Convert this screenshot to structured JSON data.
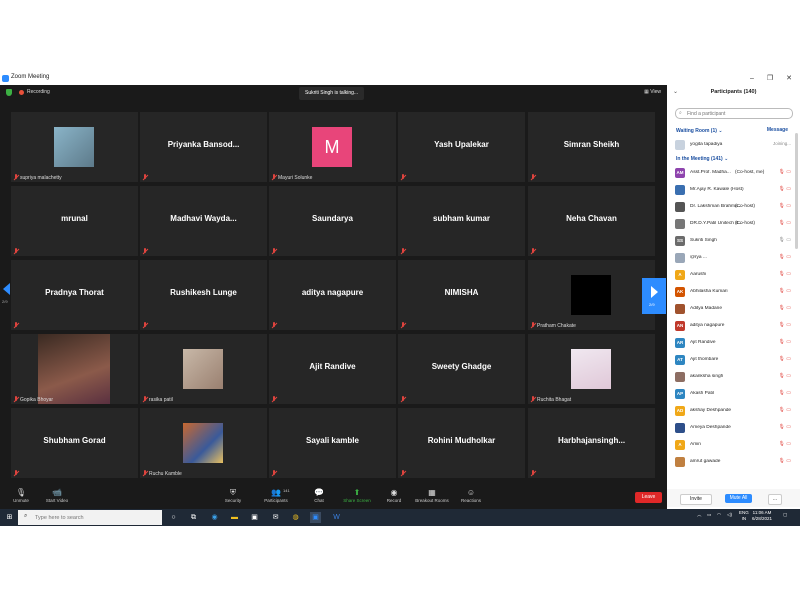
{
  "window": {
    "title": "Zoom Meeting",
    "controls": [
      "–",
      "❐",
      "✕"
    ]
  },
  "meeting": {
    "recording_label": "Recording",
    "talking_text": "Sukriti Singh is talking...",
    "view_label": "View",
    "page_prev": "2/9",
    "page_next": "2/9",
    "tiles": [
      {
        "name": "supriya malachetty",
        "type": "video"
      },
      {
        "name": "Priyanka  Bansod...",
        "type": "name"
      },
      {
        "name": "Mayuri Solunke",
        "type": "avatar",
        "letter": "M"
      },
      {
        "name": "Yash Upalekar",
        "type": "name"
      },
      {
        "name": "Simran Sheikh",
        "type": "name"
      },
      {
        "name": "mrunal",
        "type": "name"
      },
      {
        "name": "Madhavi Wayda...",
        "type": "name"
      },
      {
        "name": "Saundarya",
        "type": "name"
      },
      {
        "name": "subham kumar",
        "type": "name"
      },
      {
        "name": "Neha Chavan",
        "type": "name"
      },
      {
        "name": "Pradnya Thorat",
        "type": "name"
      },
      {
        "name": "Rushikesh Lunge",
        "type": "name"
      },
      {
        "name": "aditya nagapure",
        "type": "name"
      },
      {
        "name": "NIMISHA",
        "type": "name"
      },
      {
        "name": "Pratham Chakate",
        "type": "video"
      },
      {
        "name": "Gopika Bhoyar",
        "type": "video"
      },
      {
        "name": "rasika patil",
        "type": "video"
      },
      {
        "name": "Ajit Randive",
        "type": "name"
      },
      {
        "name": "Sweety Ghadge",
        "type": "name"
      },
      {
        "name": "Ruchita Bhagat",
        "type": "video"
      },
      {
        "name": "Shubham Gorad",
        "type": "name"
      },
      {
        "name": "Ruchu Kamble",
        "type": "video"
      },
      {
        "name": "Sayali kamble",
        "type": "name"
      },
      {
        "name": "Rohini Mudholkar",
        "type": "name"
      },
      {
        "name": "Harbhajansingh...",
        "type": "name"
      }
    ]
  },
  "toolbar": {
    "unmute": "Unmute",
    "start_video": "Start Video",
    "security": "Security",
    "participants": "Participants",
    "participants_count": "141",
    "chat": "Chat",
    "share_screen": "Share Screen",
    "record": "Record",
    "breakout_rooms": "Breakout Rooms",
    "reactions": "Reactions",
    "leave": "Leave"
  },
  "panel": {
    "title": "Participants (140)",
    "search_placeholder": "Find a participant",
    "waiting_room": "Waiting Room (1)",
    "message_link": "Message",
    "waiting": [
      {
        "name": "yogita tapadiya",
        "status": "Joining..."
      }
    ],
    "in_meeting": "In the Meeting (141)",
    "participants": [
      {
        "initials": "AM",
        "color": "#8e44ad",
        "name": "Asst.Prof. Madha...",
        "role": "(Co-host, me)"
      },
      {
        "initials": "",
        "color": "#3a6fb0",
        "name": "Mr.Ajay R. Kawale (Host)",
        "role": ""
      },
      {
        "initials": "",
        "color": "#555555",
        "name": "Dr. Lakshman Brahma...",
        "role": "(Co-host)"
      },
      {
        "initials": "",
        "color": "#777777",
        "name": "DR.D.Y.Patil Unitech S...",
        "role": "(Co-host)"
      },
      {
        "initials": "SS",
        "color": "#6b6b6b",
        "name": "Sukriti Singh",
        "role": ""
      },
      {
        "initials": "",
        "color": "#9aa7b8",
        "name": "@rya ...",
        "role": ""
      },
      {
        "initials": "A",
        "color": "#f0a818",
        "name": "Aarushi",
        "role": ""
      },
      {
        "initials": "AK",
        "color": "#d35400",
        "name": "Abhilasha Kumari",
        "role": ""
      },
      {
        "initials": "",
        "color": "#a0522d",
        "name": "Aditya Madane",
        "role": ""
      },
      {
        "initials": "AN",
        "color": "#c0392b",
        "name": "aditya nagapure",
        "role": ""
      },
      {
        "initials": "AR",
        "color": "#2e86c1",
        "name": "Ajit Randive",
        "role": ""
      },
      {
        "initials": "AT",
        "color": "#2e86c1",
        "name": "Ajit thombare",
        "role": ""
      },
      {
        "initials": "",
        "color": "#8d6e63",
        "name": "akanksha singh",
        "role": ""
      },
      {
        "initials": "AP",
        "color": "#2e86c1",
        "name": "Akash Patil",
        "role": ""
      },
      {
        "initials": "AD",
        "color": "#f0a818",
        "name": "akshay Deshpande",
        "role": ""
      },
      {
        "initials": "",
        "color": "#2e4f8a",
        "name": "Ameya Deshpande",
        "role": ""
      },
      {
        "initials": "A",
        "color": "#f0a818",
        "name": "Amin",
        "role": ""
      },
      {
        "initials": "",
        "color": "#c08040",
        "name": "amrut gawade",
        "role": ""
      }
    ],
    "invite": "Invite",
    "mute_all": "Mute All",
    "more": "..."
  },
  "taskbar": {
    "search_placeholder": "Type here to search",
    "lang1": "ENG",
    "lang2": "IN",
    "time": "11:06 AM",
    "date": "6/28/2021"
  },
  "colors": {
    "accent": "#2d8cff",
    "muted_red": "#e0443e",
    "leave_red": "#e02828",
    "share_green": "#3cb043",
    "mayuri_avatar": "#e8457a"
  }
}
